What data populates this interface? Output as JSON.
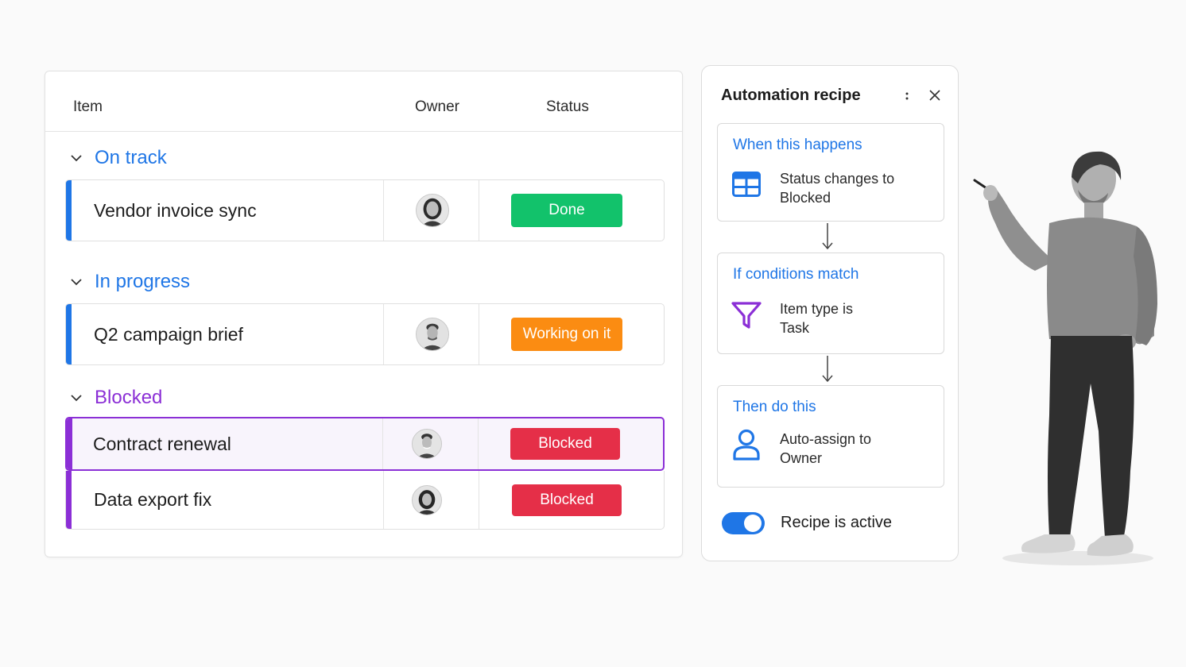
{
  "board": {
    "columns": {
      "item": "Item",
      "owner": "Owner",
      "status": "Status"
    },
    "groups": [
      {
        "title": "On track",
        "color": "#1f76e6",
        "rows": [
          {
            "name": "Vendor invoice sync",
            "status": "Done",
            "status_color": "#12c26b"
          }
        ]
      },
      {
        "title": "In progress",
        "color": "#1f76e6",
        "rows": [
          {
            "name": "Q2 campaign brief",
            "status": "Working on it",
            "status_color": "#fb8c12"
          }
        ]
      },
      {
        "title": "Blocked",
        "color": "#8b2fd6",
        "rows": [
          {
            "name": "Contract renewal",
            "status": "Blocked",
            "status_color": "#e52f48",
            "selected": true
          },
          {
            "name": "Data export fix",
            "status": "Blocked",
            "status_color": "#e52f48"
          }
        ]
      }
    ]
  },
  "recipe": {
    "title": "Automation recipe",
    "more_icon": "more-vertical-icon",
    "close_icon": "close-icon",
    "steps": [
      {
        "label": "When this happens",
        "icon": "table-icon",
        "text_line1": "Status changes to",
        "text_line2": "Blocked"
      },
      {
        "label": "If conditions match",
        "icon": "filter-icon",
        "text_line1": "Item type is",
        "text_line2": "Task"
      },
      {
        "label": "Then do this",
        "icon": "person-icon",
        "text_line1": "Auto-assign to",
        "text_line2": "Owner"
      }
    ],
    "toggle": {
      "label": "Recipe is active",
      "on": true
    }
  },
  "colors": {
    "accent_blue": "#1f76e6",
    "accent_purple": "#8b2fd6",
    "done": "#12c26b",
    "working": "#fb8c12",
    "blocked": "#e52f48"
  }
}
